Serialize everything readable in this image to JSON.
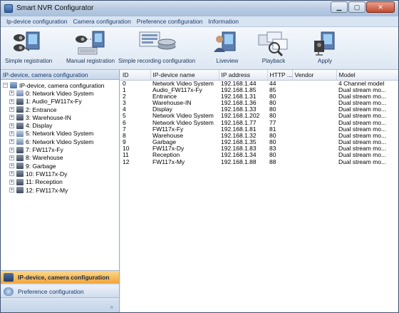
{
  "window": {
    "title": "Smart NVR Configurator"
  },
  "menu": [
    "Ip-device configuration",
    "Camera configuration",
    "Preference configuration",
    "Information"
  ],
  "toolbar": {
    "simple_registration": "Simple registration",
    "manual_registration": "Manual registration",
    "simple_recording": "Simple recording configuration",
    "liveview": "Liveview",
    "playback": "Playback",
    "apply": "Apply"
  },
  "left_panel": {
    "header": "IP-device, camera configuration",
    "root": "IP-device, camera configuration",
    "nodes": [
      {
        "label": "0: Network Video System",
        "icon": "nvs-icon"
      },
      {
        "label": "1: Audio_FW117x-Fy",
        "icon": "camera-icon"
      },
      {
        "label": "2: Entrance",
        "icon": "camera-icon"
      },
      {
        "label": "3: Warehouse-IN",
        "icon": "camera-icon"
      },
      {
        "label": "4: Display",
        "icon": "camera-icon"
      },
      {
        "label": "5: Network Video System",
        "icon": "nvs-icon"
      },
      {
        "label": "6: Network Video System",
        "icon": "nvs-icon"
      },
      {
        "label": "7: FW117x-Fy",
        "icon": "camera-icon"
      },
      {
        "label": "8: Warehouse",
        "icon": "camera-icon"
      },
      {
        "label": "9: Garbage",
        "icon": "camera-icon"
      },
      {
        "label": "10: FW117x-Dy",
        "icon": "camera-icon"
      },
      {
        "label": "11: Reception",
        "icon": "camera-icon"
      },
      {
        "label": "12: FW117x-My",
        "icon": "camera-icon"
      }
    ],
    "nav": {
      "camera_config": "IP-device, camera configuration",
      "preference_config": "Preference configuration",
      "grip": "»"
    }
  },
  "table": {
    "columns": [
      "ID",
      "IP-device name",
      "IP address",
      "HTTP ...",
      "Vendor",
      "Model"
    ],
    "rows": [
      [
        "0",
        "Network Video System",
        "192.168.1.44",
        "44",
        "",
        "4 Channel model"
      ],
      [
        "1",
        "Audio_FW117x-Fy",
        "192.168.1.85",
        "85",
        "",
        "Dual stream mo..."
      ],
      [
        "2",
        "Entrance",
        "192.168.1.31",
        "80",
        "",
        "Dual stream mo..."
      ],
      [
        "3",
        "Warehouse-IN",
        "192.168.1.36",
        "80",
        "",
        "Dual stream mo..."
      ],
      [
        "4",
        "Display",
        "192.168.1.33",
        "80",
        "",
        "Dual stream mo..."
      ],
      [
        "5",
        "Network Video System",
        "192.168.1.202",
        "80",
        "",
        "Dual stream mo..."
      ],
      [
        "6",
        "Network Video System",
        "192.168.1.77",
        "77",
        "",
        "Dual stream mo..."
      ],
      [
        "7",
        "FW117x-Fy",
        "192.168.1.81",
        "81",
        "",
        "Dual stream mo..."
      ],
      [
        "8",
        "Warehouse",
        "192.168.1.32",
        "80",
        "",
        "Dual stream mo..."
      ],
      [
        "9",
        "Garbage",
        "192.168.1.35",
        "80",
        "",
        "Dual stream mo..."
      ],
      [
        "10",
        "FW117x-Dy",
        "192.168.1.83",
        "83",
        "",
        "Dual stream mo..."
      ],
      [
        "11",
        "Reception",
        "192.168.1.34",
        "80",
        "",
        "Dual stream mo..."
      ],
      [
        "12",
        "FW117x-My",
        "192.168.1.88",
        "88",
        "",
        "Dual stream mo..."
      ]
    ]
  }
}
